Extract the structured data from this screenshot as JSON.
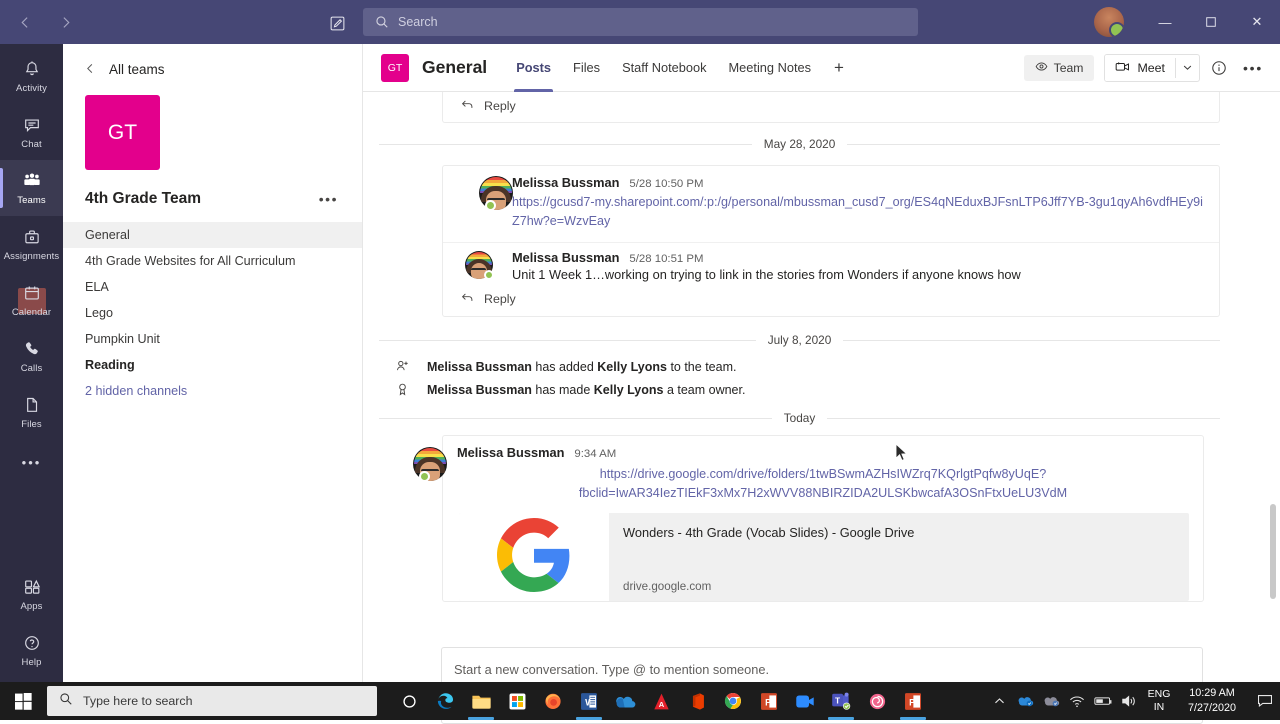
{
  "titlebar": {
    "back_icon": "back-arrow-icon",
    "forward_icon": "forward-arrow-icon",
    "compose_icon": "compose-message-icon",
    "search_placeholder": "Search",
    "minimize_label": "—",
    "maximize_label": "❐",
    "close_label": "✕"
  },
  "rail": {
    "items": [
      {
        "label": "Activity",
        "icon": "bell-icon"
      },
      {
        "label": "Chat",
        "icon": "chat-bubble-icon"
      },
      {
        "label": "Teams",
        "icon": "teams-people-icon"
      },
      {
        "label": "Assignments",
        "icon": "assignments-bag-icon"
      },
      {
        "label": "Calendar",
        "icon": "calendar-icon"
      },
      {
        "label": "Calls",
        "icon": "phone-icon"
      },
      {
        "label": "Files",
        "icon": "file-icon"
      }
    ],
    "more_label": "•••",
    "apps_label": "Apps",
    "apps_icon": "apps-grid-icon",
    "help_label": "Help",
    "help_icon": "help-question-icon"
  },
  "channel_pane": {
    "all_teams_label": "All teams",
    "team_initials": "GT",
    "team_name": "4th Grade Team",
    "team_more_label": "•••",
    "channels": [
      {
        "name": "General",
        "selected": true,
        "unread": false,
        "hidden_link": false
      },
      {
        "name": "4th Grade Websites for All Curriculum",
        "selected": false,
        "unread": false,
        "hidden_link": false
      },
      {
        "name": "ELA",
        "selected": false,
        "unread": false,
        "hidden_link": false
      },
      {
        "name": "Lego",
        "selected": false,
        "unread": false,
        "hidden_link": false
      },
      {
        "name": "Pumpkin Unit",
        "selected": false,
        "unread": false,
        "hidden_link": false
      },
      {
        "name": "Reading",
        "selected": false,
        "unread": true,
        "hidden_link": false
      },
      {
        "name": "2 hidden channels",
        "selected": false,
        "unread": false,
        "hidden_link": true
      }
    ]
  },
  "channel_header": {
    "avatar_initials": "GT",
    "title": "General",
    "tabs": [
      {
        "label": "Posts",
        "selected": true
      },
      {
        "label": "Files",
        "selected": false
      },
      {
        "label": "Staff Notebook",
        "selected": false
      },
      {
        "label": "Meeting Notes",
        "selected": false
      }
    ],
    "add_tab_label": "+",
    "team_button_label": "Team",
    "team_button_icon": "eye-icon",
    "meet_button_label": "Meet",
    "meet_button_icon": "video-camera-icon",
    "meet_caret_label": "⌄",
    "info_icon": "info-circle-icon",
    "more_icon": "more-horizontal-icon"
  },
  "conversation": {
    "top_reply_label": "Reply",
    "reply_icon": "reply-arrow-icon",
    "date_separator_1": "May 28, 2020",
    "message_1": {
      "author": "Melissa Bussman",
      "time": "5/28 10:50 PM",
      "link": "https://gcusd7-my.sharepoint.com/:p:/g/personal/mbussman_cusd7_org/ES4qNEduxBJFsnLTP6Jff7YB-3gu1qyAh6vdfHEy9iZ7hw?e=WzvEay"
    },
    "message_2": {
      "author": "Melissa Bussman",
      "time": "5/28 10:51 PM",
      "text": "Unit 1 Week 1…working on trying to link in the stories from Wonders if anyone knows how",
      "reply_label": "Reply"
    },
    "date_separator_2": "July 8, 2020",
    "system_messages": [
      {
        "icon": "add-person-icon",
        "prefix": "Melissa Bussman",
        "middle": " has added ",
        "bold2": "Kelly Lyons",
        "suffix": " to the team."
      },
      {
        "icon": "owner-crown-icon",
        "prefix": "Melissa Bussman",
        "middle": " has made ",
        "bold2": "Kelly Lyons",
        "suffix": " a team owner."
      }
    ],
    "date_separator_3": "Today",
    "message_3": {
      "author": "Melissa Bussman",
      "time": "9:34 AM",
      "link_line_1": "https://drive.google.com/drive/folders/1twBSwmAZHsIWZrq7KQrlgtPqfw8yUqE?",
      "link_line_2": "fbclid=IwAR34IezTIEkF3xMx7H2xWVV88NBIRZIDA2ULSKbwcafA3OSnFtxUeLU3VdM",
      "card_title": "Wonders - 4th Grade (Vocab Slides) - Google Drive",
      "card_domain": "drive.google.com",
      "card_thumb_icon": "google-logo-icon"
    }
  },
  "compose": {
    "placeholder": "Start a new conversation. Type @ to mention someone.",
    "tools": [
      {
        "icon": "format-text-icon",
        "name": "format-button"
      },
      {
        "icon": "attach-paperclip-icon",
        "name": "attach-button"
      },
      {
        "icon": "emoji-smiley-icon",
        "name": "emoji-button"
      },
      {
        "icon": "gif-icon",
        "name": "giphy-button"
      },
      {
        "icon": "sticker-icon",
        "name": "sticker-button"
      },
      {
        "icon": "stream-icon",
        "name": "stream-button"
      },
      {
        "icon": "praise-icon",
        "name": "praise-button"
      },
      {
        "icon": "flame-icon",
        "name": "flipgrid-button"
      },
      {
        "icon": "more-horizontal-icon",
        "name": "more-options-button"
      }
    ],
    "send_icon": "send-arrow-icon"
  },
  "taskbar": {
    "start_icon": "windows-start-icon",
    "search_icon": "search-magnifier-icon",
    "search_placeholder": "Type here to search",
    "apps": [
      {
        "name": "cortana",
        "active": false
      },
      {
        "name": "microsoft-edge",
        "active": false
      },
      {
        "name": "file-explorer",
        "active": true
      },
      {
        "name": "microsoft-store",
        "active": false
      },
      {
        "name": "firefox",
        "active": false
      },
      {
        "name": "microsoft-word",
        "active": true
      },
      {
        "name": "onedrive",
        "active": false
      },
      {
        "name": "adobe-acrobat",
        "active": false
      },
      {
        "name": "microsoft-office",
        "active": false
      },
      {
        "name": "google-chrome",
        "active": false
      },
      {
        "name": "microsoft-publisher",
        "active": false
      },
      {
        "name": "zoom",
        "active": false
      },
      {
        "name": "microsoft-teams",
        "active": true
      },
      {
        "name": "spiral",
        "active": false
      },
      {
        "name": "microsoft-powerpoint",
        "active": true
      }
    ],
    "tray": {
      "chevron_label": "⌃",
      "language_line1": "ENG",
      "language_line2": "IN",
      "time": "10:29 AM",
      "date": "7/27/2020",
      "wifi_icon": "wifi-icon",
      "battery_icon": "battery-icon",
      "volume_icon": "volume-icon",
      "action_center_icon": "action-center-icon"
    }
  },
  "colors": {
    "teams_purple": "#464775",
    "accent_purple": "#6264a7",
    "team_magenta": "#e3008c",
    "presence_green": "#92c353",
    "rail_dark": "#2d2c41"
  }
}
